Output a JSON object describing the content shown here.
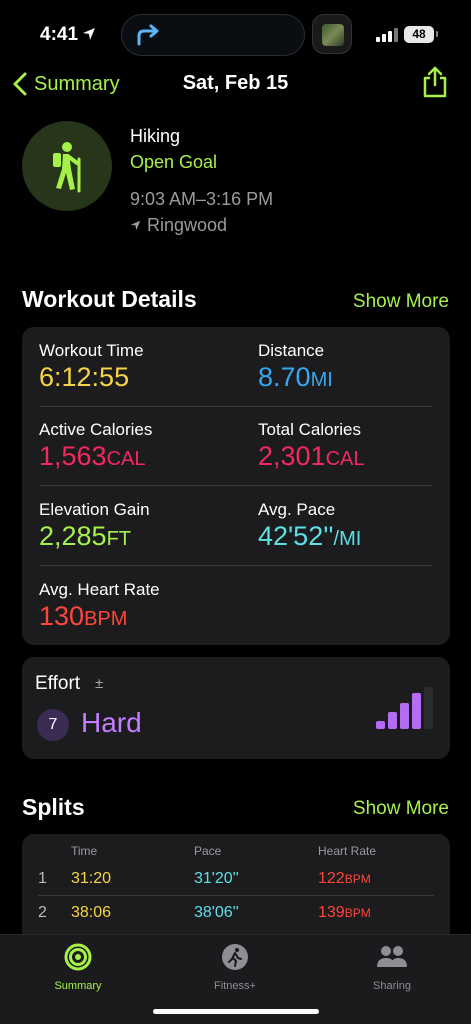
{
  "status": {
    "time": "4:41",
    "battery": "48"
  },
  "nav": {
    "back_label": "Summary",
    "title": "Sat, Feb 15"
  },
  "workout": {
    "type": "Hiking",
    "goal": "Open Goal",
    "time_range": "9:03 AM–3:16 PM",
    "location": "Ringwood"
  },
  "details": {
    "title": "Workout Details",
    "show_more": "Show More",
    "workout_time": {
      "label": "Workout Time",
      "value": "6:12:55",
      "unit": ""
    },
    "distance": {
      "label": "Distance",
      "value": "8.70",
      "unit": "MI"
    },
    "active_calories": {
      "label": "Active Calories",
      "value": "1,563",
      "unit": "CAL"
    },
    "total_calories": {
      "label": "Total Calories",
      "value": "2,301",
      "unit": "CAL"
    },
    "elevation_gain": {
      "label": "Elevation Gain",
      "value": "2,285",
      "unit": "FT"
    },
    "avg_pace": {
      "label": "Avg. Pace",
      "value": "42'52''",
      "unit": "/MI"
    },
    "avg_heart_rate": {
      "label": "Avg. Heart Rate",
      "value": "130",
      "unit": "BPM"
    }
  },
  "effort": {
    "label": "Effort",
    "adjust_symbol": "±",
    "score": "7",
    "value": "Hard",
    "level": 0.7
  },
  "splits": {
    "title": "Splits",
    "show_more": "Show More",
    "headers": {
      "time": "Time",
      "pace": "Pace",
      "heart_rate": "Heart Rate"
    },
    "rows": [
      {
        "num": "1",
        "time": "31:20",
        "pace": "31'20''",
        "hr": "122",
        "hr_unit": "BPM"
      },
      {
        "num": "2",
        "time": "38:06",
        "pace": "38'06''",
        "hr": "139",
        "hr_unit": "BPM"
      }
    ]
  },
  "tabbar": {
    "summary": "Summary",
    "fitness_plus": "Fitness+",
    "sharing": "Sharing"
  },
  "colors": {
    "accent": "#a6f04a",
    "time": "#f5d547",
    "distance": "#36a7f0",
    "calories": "#f2295f",
    "pace": "#5ce0e6",
    "heart_rate": "#ff453a",
    "effort": "#c47dff"
  }
}
